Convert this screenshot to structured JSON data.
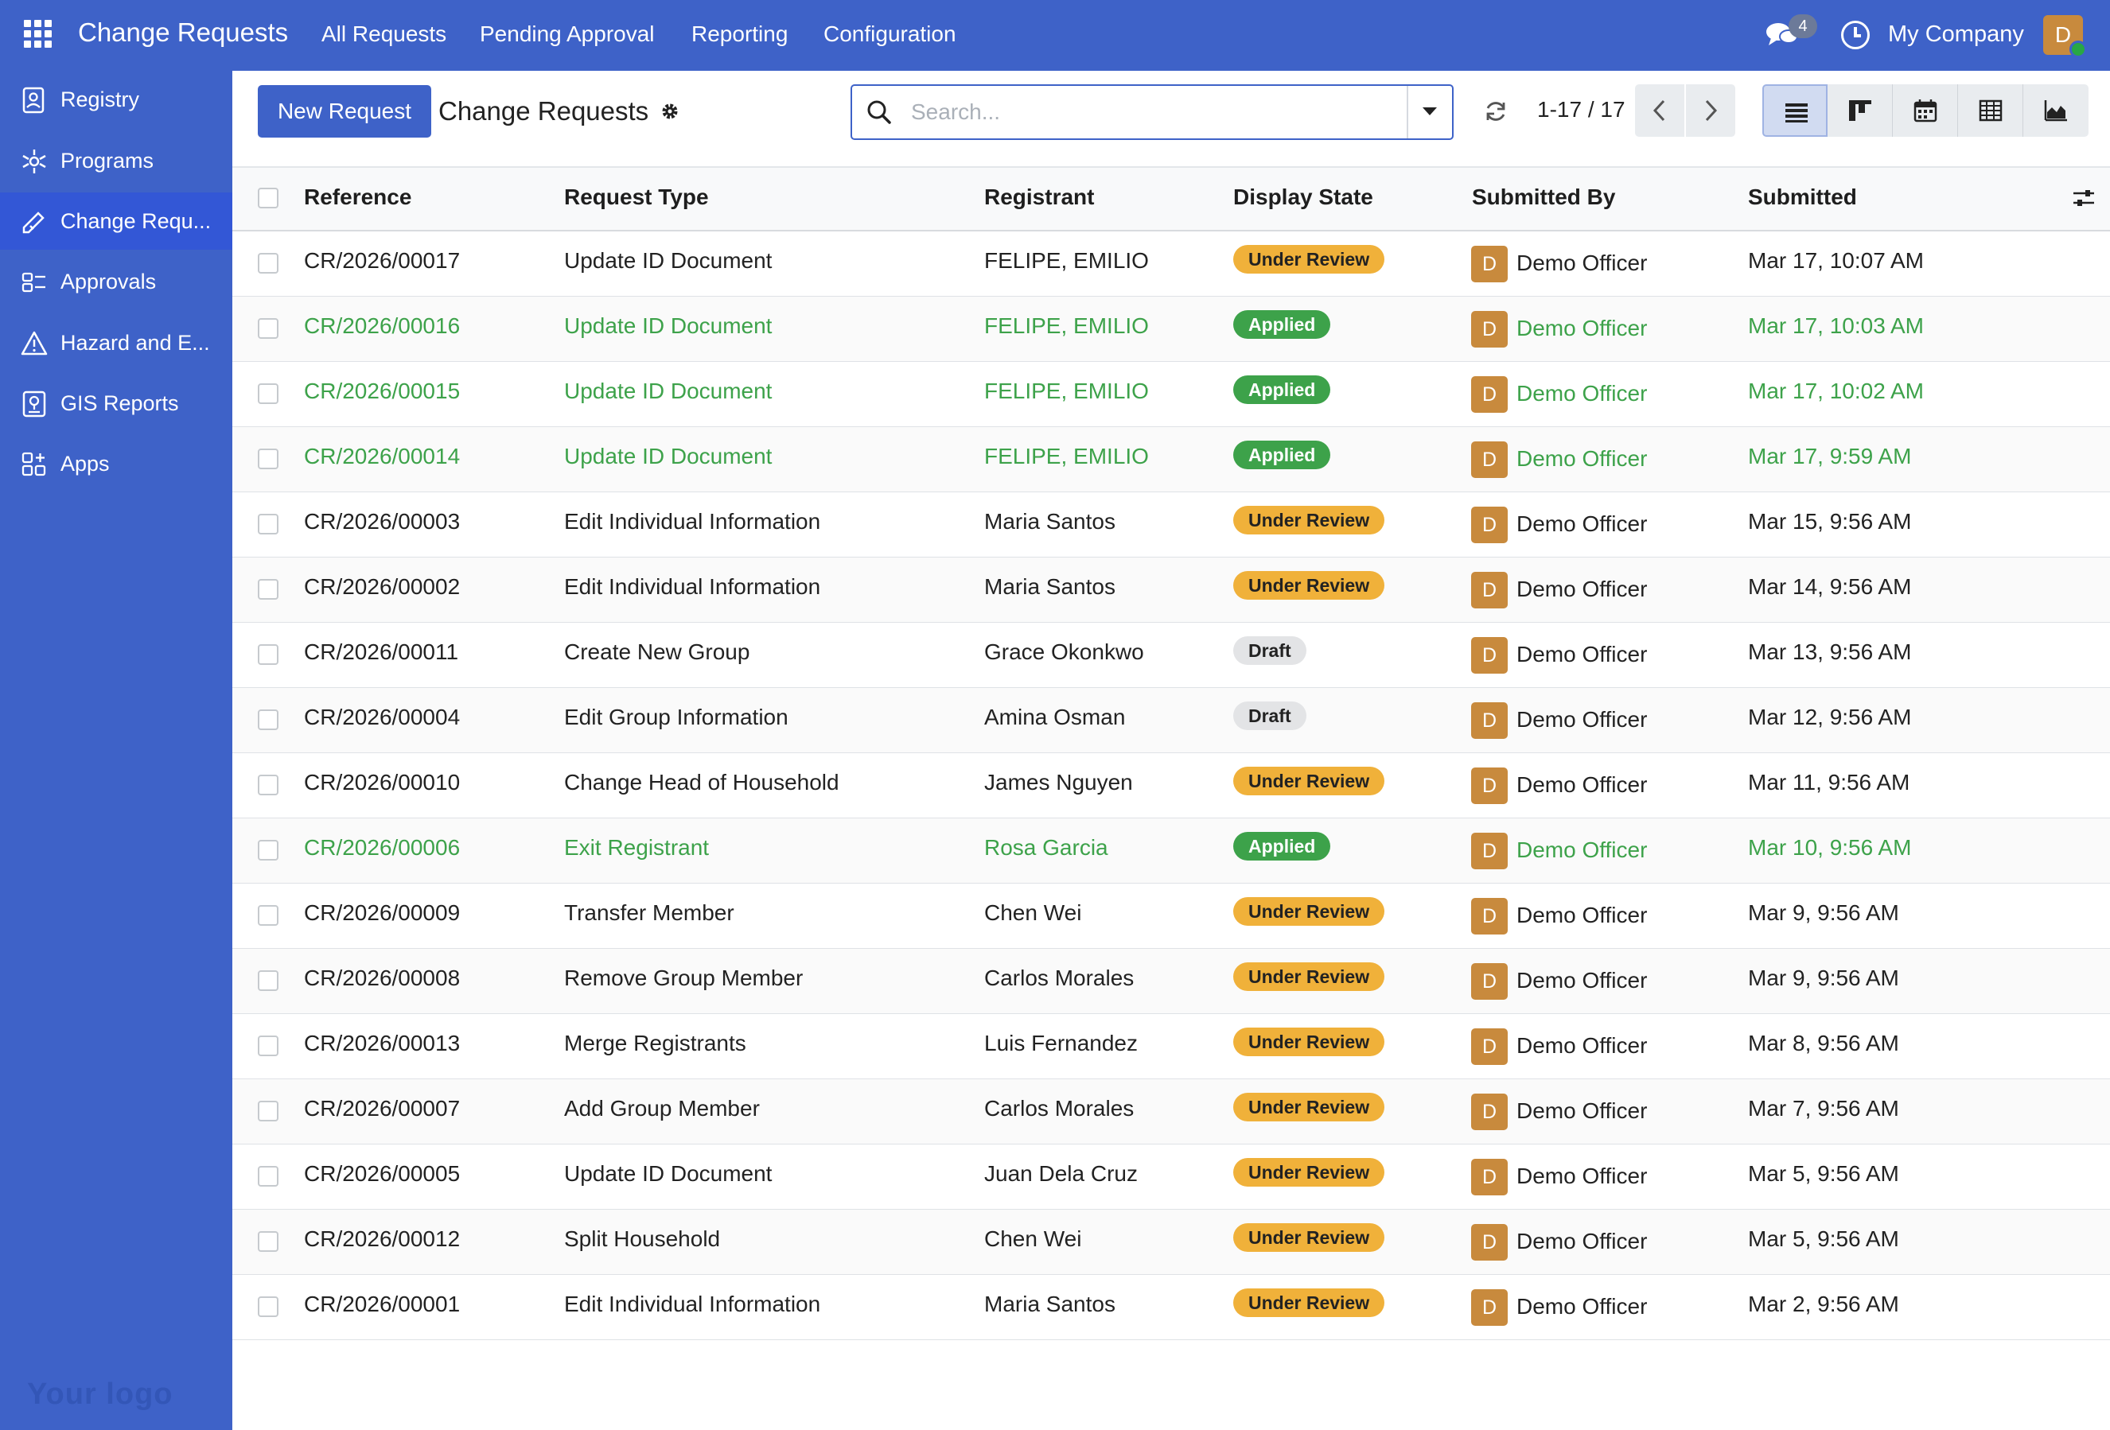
{
  "app": {
    "title": "Change Requests"
  },
  "topnav": {
    "items": [
      "All Requests",
      "Pending Approval",
      "Reporting",
      "Configuration"
    ],
    "chat_badge": "4",
    "company": "My Company",
    "user_initial": "D"
  },
  "sidebar": {
    "items": [
      {
        "label": "Registry",
        "icon": "registry-icon"
      },
      {
        "label": "Programs",
        "icon": "programs-icon"
      },
      {
        "label": "Change Requ...",
        "icon": "change-requests-icon"
      },
      {
        "label": "Approvals",
        "icon": "approvals-icon"
      },
      {
        "label": "Hazard and E...",
        "icon": "hazard-icon"
      },
      {
        "label": "GIS Reports",
        "icon": "gis-icon"
      },
      {
        "label": "Apps",
        "icon": "apps-icon"
      }
    ],
    "active_index": 2,
    "logo_text": "Your logo"
  },
  "control": {
    "new_button": "New Request",
    "title": "Change Requests",
    "search_placeholder": "Search...",
    "pager": "1-17 / 17"
  },
  "table": {
    "headers": [
      "Reference",
      "Request Type",
      "Registrant",
      "Display State",
      "Submitted By",
      "Submitted"
    ],
    "rows": [
      {
        "ref": "CR/2026/00017",
        "type": "Update ID Document",
        "registrant": "FELIPE, EMILIO",
        "state": "Under Review",
        "by": "Demo Officer",
        "initial": "D",
        "submitted": "Mar 17, 10:07 AM"
      },
      {
        "ref": "CR/2026/00016",
        "type": "Update ID Document",
        "registrant": "FELIPE, EMILIO",
        "state": "Applied",
        "by": "Demo Officer",
        "initial": "D",
        "submitted": "Mar 17, 10:03 AM"
      },
      {
        "ref": "CR/2026/00015",
        "type": "Update ID Document",
        "registrant": "FELIPE, EMILIO",
        "state": "Applied",
        "by": "Demo Officer",
        "initial": "D",
        "submitted": "Mar 17, 10:02 AM"
      },
      {
        "ref": "CR/2026/00014",
        "type": "Update ID Document",
        "registrant": "FELIPE, EMILIO",
        "state": "Applied",
        "by": "Demo Officer",
        "initial": "D",
        "submitted": "Mar 17, 9:59 AM"
      },
      {
        "ref": "CR/2026/00003",
        "type": "Edit Individual Information",
        "registrant": "Maria Santos",
        "state": "Under Review",
        "by": "Demo Officer",
        "initial": "D",
        "submitted": "Mar 15, 9:56 AM"
      },
      {
        "ref": "CR/2026/00002",
        "type": "Edit Individual Information",
        "registrant": "Maria Santos",
        "state": "Under Review",
        "by": "Demo Officer",
        "initial": "D",
        "submitted": "Mar 14, 9:56 AM"
      },
      {
        "ref": "CR/2026/00011",
        "type": "Create New Group",
        "registrant": "Grace Okonkwo",
        "state": "Draft",
        "by": "Demo Officer",
        "initial": "D",
        "submitted": "Mar 13, 9:56 AM"
      },
      {
        "ref": "CR/2026/00004",
        "type": "Edit Group Information",
        "registrant": "Amina Osman",
        "state": "Draft",
        "by": "Demo Officer",
        "initial": "D",
        "submitted": "Mar 12, 9:56 AM"
      },
      {
        "ref": "CR/2026/00010",
        "type": "Change Head of Household",
        "registrant": "James Nguyen",
        "state": "Under Review",
        "by": "Demo Officer",
        "initial": "D",
        "submitted": "Mar 11, 9:56 AM"
      },
      {
        "ref": "CR/2026/00006",
        "type": "Exit Registrant",
        "registrant": "Rosa Garcia",
        "state": "Applied",
        "by": "Demo Officer",
        "initial": "D",
        "submitted": "Mar 10, 9:56 AM"
      },
      {
        "ref": "CR/2026/00009",
        "type": "Transfer Member",
        "registrant": "Chen Wei",
        "state": "Under Review",
        "by": "Demo Officer",
        "initial": "D",
        "submitted": "Mar 9, 9:56 AM"
      },
      {
        "ref": "CR/2026/00008",
        "type": "Remove Group Member",
        "registrant": "Carlos Morales",
        "state": "Under Review",
        "by": "Demo Officer",
        "initial": "D",
        "submitted": "Mar 9, 9:56 AM"
      },
      {
        "ref": "CR/2026/00013",
        "type": "Merge Registrants",
        "registrant": "Luis Fernandez",
        "state": "Under Review",
        "by": "Demo Officer",
        "initial": "D",
        "submitted": "Mar 8, 9:56 AM"
      },
      {
        "ref": "CR/2026/00007",
        "type": "Add Group Member",
        "registrant": "Carlos Morales",
        "state": "Under Review",
        "by": "Demo Officer",
        "initial": "D",
        "submitted": "Mar 7, 9:56 AM"
      },
      {
        "ref": "CR/2026/00005",
        "type": "Update ID Document",
        "registrant": "Juan Dela Cruz",
        "state": "Under Review",
        "by": "Demo Officer",
        "initial": "D",
        "submitted": "Mar 5, 9:56 AM"
      },
      {
        "ref": "CR/2026/00012",
        "type": "Split Household",
        "registrant": "Chen Wei",
        "state": "Under Review",
        "by": "Demo Officer",
        "initial": "D",
        "submitted": "Mar 5, 9:56 AM"
      },
      {
        "ref": "CR/2026/00001",
        "type": "Edit Individual Information",
        "registrant": "Maria Santos",
        "state": "Under Review",
        "by": "Demo Officer",
        "initial": "D",
        "submitted": "Mar 2, 9:56 AM"
      }
    ]
  },
  "colors": {
    "brand": "#3e62c8",
    "applied": "#3da24a",
    "review": "#f0b13a",
    "draft": "#e3e4e6",
    "avatar": "#c88a3d"
  }
}
